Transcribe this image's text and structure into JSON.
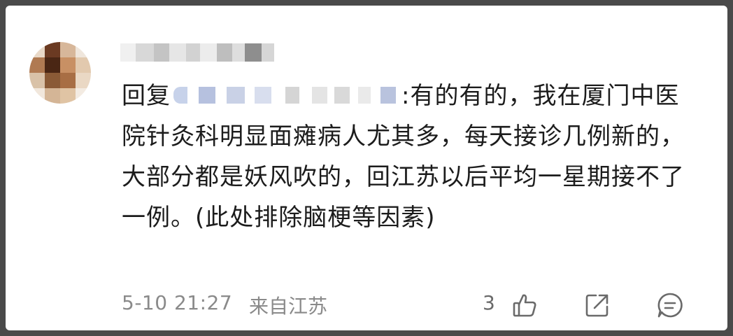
{
  "comment": {
    "reply_prefix": "回复",
    "text_after_mention": ":有的有的，我在厦门中医院针灸科明显面瘫病人尤其多，每天接诊几例新的，大部分都是妖风吹的，回江苏以后平均一星期接不了一例。(此处排除脑梗等因素)",
    "time": "5-10 21:27",
    "location": "来自江苏",
    "like_count": "3"
  },
  "icons": {
    "like": "thumbs-up-icon",
    "share": "share-icon",
    "reply": "comment-icon"
  },
  "colors": {
    "text": "#1c1c1c",
    "meta": "#8a8a8a",
    "icon": "#6a6a6a",
    "background": "#ffffff"
  }
}
